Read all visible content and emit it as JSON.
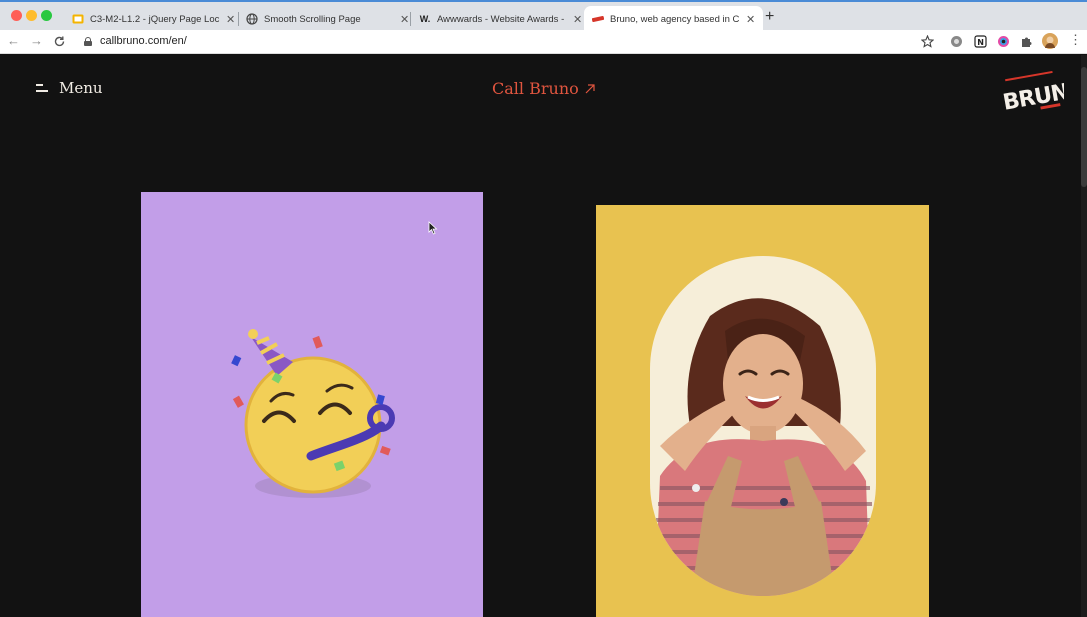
{
  "browser": {
    "tabs": [
      {
        "label": "C3-M2-L1.2 - jQuery Page Loc",
        "favicon": "slides-icon"
      },
      {
        "label": "Smooth Scrolling Page",
        "favicon": "globe-icon"
      },
      {
        "label": "Awwwards - Website Awards -",
        "favicon": "w-icon"
      },
      {
        "label": "Bruno, web agency based in C",
        "favicon": "bruno-icon",
        "active": true
      }
    ],
    "url": "callbruno.com/en/"
  },
  "page": {
    "menu_label": "Menu",
    "call_label": "Call Bruno",
    "logo_text": "BRUNO",
    "colors": {
      "background": "#121212",
      "accent": "#e0553f",
      "purple_card": "#c29ee8",
      "yellow_card": "#e8c250"
    },
    "cards": [
      {
        "image": "party-face-emoji"
      },
      {
        "image": "smiling-woman-portrait"
      }
    ]
  }
}
